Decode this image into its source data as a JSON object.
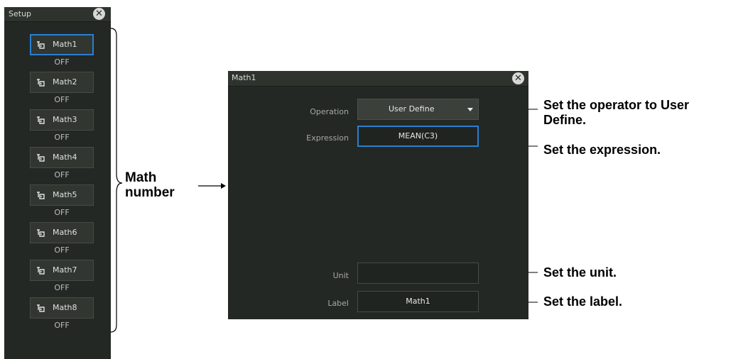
{
  "setup_panel": {
    "title": "Setup",
    "items": [
      {
        "label": "Math1",
        "status": "OFF",
        "selected": true
      },
      {
        "label": "Math2",
        "status": "OFF"
      },
      {
        "label": "Math3",
        "status": "OFF"
      },
      {
        "label": "Math4",
        "status": "OFF"
      },
      {
        "label": "Math5",
        "status": "OFF"
      },
      {
        "label": "Math6",
        "status": "OFF"
      },
      {
        "label": "Math7",
        "status": "OFF"
      },
      {
        "label": "Math8",
        "status": "OFF"
      }
    ]
  },
  "math_dialog": {
    "title": "Math1",
    "operation": {
      "label": "Operation",
      "value": "User Define"
    },
    "expression": {
      "label": "Expression",
      "value": "MEAN(C3)"
    },
    "unit": {
      "label": "Unit",
      "value": ""
    },
    "label_field": {
      "label": "Label",
      "value": "Math1"
    }
  },
  "annotations": {
    "math_number": [
      "Math",
      "number"
    ],
    "operation": [
      "Set the operator to User",
      "Define."
    ],
    "expression": "Set the expression.",
    "unit": "Set the unit.",
    "label": "Set the label."
  },
  "colors": {
    "panel_bg": "#242824",
    "header_bg": "#2e332e",
    "focus_border": "#2a7fd0",
    "text": "#e0e0e0"
  }
}
